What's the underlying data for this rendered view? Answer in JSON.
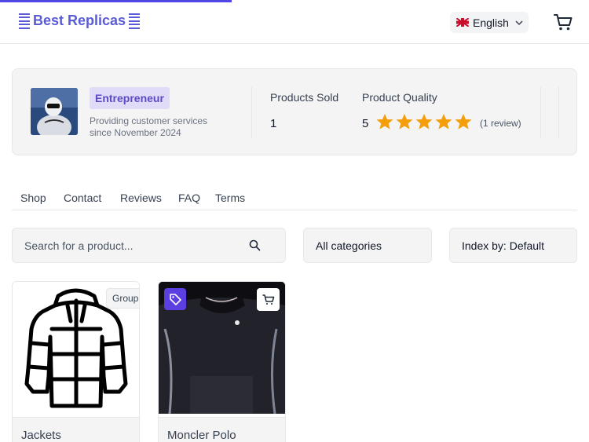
{
  "header": {
    "brand": "Best Replicas",
    "language": "English"
  },
  "vendor": {
    "badge": "Entrepreneur",
    "description": "Providing customer services since November 2024",
    "products_sold_label": "Products Sold",
    "products_sold_value": "1",
    "quality_label": "Product Quality",
    "quality_value": "5",
    "rating_stars": 5,
    "review_count": "(1 review)"
  },
  "tabs": [
    "Shop",
    "Contact",
    "Reviews",
    "FAQ",
    "Terms"
  ],
  "filters": {
    "search_placeholder": "Search for a product...",
    "category": "All categories",
    "sort": "Index by: Default"
  },
  "products": [
    {
      "name": "Jackets",
      "tag": "Group"
    },
    {
      "name": "Moncler Polo"
    }
  ],
  "colors": {
    "accent": "#5b5bd6",
    "star": "#f59e0b",
    "tag_button": "#5b3fe0"
  }
}
